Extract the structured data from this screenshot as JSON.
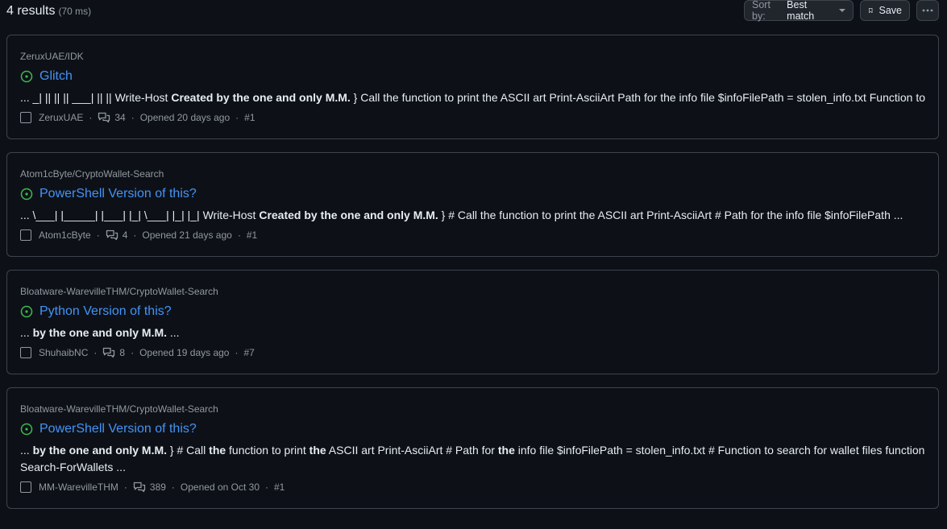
{
  "header": {
    "results_label": "4 results",
    "time_label": "(70 ms)",
    "sort_prefix": "Sort by:",
    "sort_value": "Best match",
    "save_label": "Save"
  },
  "results": [
    {
      "repo": "ZeruxUAE/IDK",
      "title": "Glitch",
      "snippet_parts": [
        "... _| || || || ___| || || Write-Host ",
        "Created by the one and only M.M.",
        " } Call the function to print the ASCII art Print-AsciiArt Path for the info file $infoFilePath = stolen_info.txt Function to ..."
      ],
      "author": "ZeruxUAE",
      "comments": "34",
      "opened": "Opened 20 days ago",
      "number": "#1"
    },
    {
      "repo": "Atom1cByte/CryptoWallet-Search",
      "title": "PowerShell Version of this?",
      "snippet_parts": [
        "... \\___| |_____| |___| |_| \\___| |_| |_| Write-Host ",
        "Created by the one and only M.M.",
        " } # Call the function to print the ASCII art Print-AsciiArt # Path for the info file $infoFilePath ..."
      ],
      "author": "Atom1cByte",
      "comments": "4",
      "opened": "Opened 21 days ago",
      "number": "#1"
    },
    {
      "repo": "Bloatware-WarevilleTHM/CryptoWallet-Search",
      "title": "Python Version of this?",
      "snippet_parts": [
        "... ",
        "by the one and only M.M.",
        " ..."
      ],
      "author": "ShuhaibNC",
      "comments": "8",
      "opened": "Opened 19 days ago",
      "number": "#7"
    },
    {
      "repo": "Bloatware-WarevilleTHM/CryptoWallet-Search",
      "title": "PowerShell Version of this?",
      "snippet_parts": [
        "... ",
        "by the one and only M.M.",
        " } # Call ",
        "the",
        " function to print ",
        "the",
        " ASCII art Print-AsciiArt # Path for ",
        "the",
        " info file $infoFilePath = stolen_info.txt # Function to search for wallet files function Search-ForWallets ..."
      ],
      "author": "MM-WarevilleTHM",
      "comments": "389",
      "opened": "Opened on Oct 30",
      "number": "#1"
    }
  ],
  "colors": {
    "background": "#0d1117",
    "link": "#4493f8",
    "open_icon": "#3fb950",
    "muted": "#9198a1",
    "border": "#3d444d"
  },
  "icons": {
    "open": "issue-opened-icon",
    "comments": "comment-discussion-icon",
    "save": "bookmark-icon",
    "more": "kebab-horizontal-icon"
  }
}
